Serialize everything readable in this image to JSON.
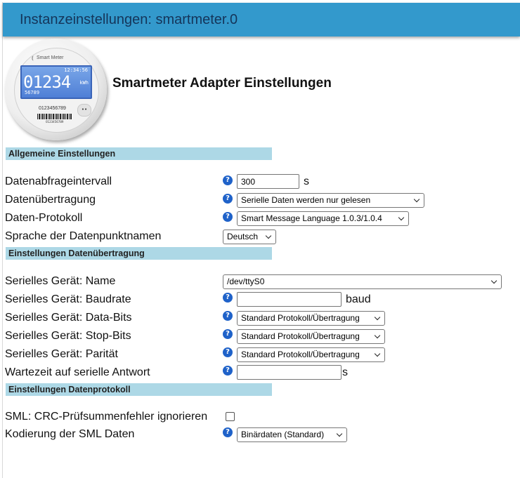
{
  "window": {
    "title": "Instanzeinstellungen: smartmeter.0"
  },
  "logo": {
    "brand": "Smart Meter",
    "time": "12:34:56",
    "reading": "01234",
    "unit": "kWh",
    "sub": "56789",
    "serial": "0123456789",
    "barcode_number": "0123456789",
    "dots": "••"
  },
  "page_title": "Smartmeter Adapter Einstellungen",
  "sections": {
    "general": "Allgemeine Einstellungen",
    "transfer": "Einstellungen Datenübertragung",
    "protocol": "Einstellungen Datenprotokoll"
  },
  "general": {
    "interval": {
      "label": "Datenabfrageintervall",
      "value": "300",
      "unit": "s"
    },
    "transfer": {
      "label": "Datenübertragung",
      "value": "Serielle Daten werden nur gelesen"
    },
    "protocol": {
      "label": "Daten-Protokoll",
      "value": "Smart Message Language 1.0.3/1.0.4"
    },
    "language": {
      "label": "Sprache der Datenpunktnamen",
      "value": "Deutsch"
    }
  },
  "serial": {
    "name": {
      "label": "Serielles Gerät: Name",
      "value": "/dev/ttyS0"
    },
    "baud": {
      "label": "Serielles Gerät: Baudrate",
      "value": "",
      "unit": "baud"
    },
    "databits": {
      "label": "Serielles Gerät: Data-Bits",
      "value": "Standard Protokoll/Übertragung"
    },
    "stopbits": {
      "label": "Serielles Gerät: Stop-Bits",
      "value": "Standard Protokoll/Übertragung"
    },
    "parity": {
      "label": "Serielles Gerät: Parität",
      "value": "Standard Protokoll/Übertragung"
    },
    "wait": {
      "label": "Wartezeit auf serielle Antwort",
      "value": "",
      "unit": "s"
    }
  },
  "protocol": {
    "crc": {
      "label": "SML: CRC-Prüfsummenfehler ignorieren",
      "checked": false
    },
    "encoding": {
      "label": "Kodierung der SML Daten",
      "value": "Binärdaten (Standard)"
    }
  },
  "help_glyph": "?",
  "colors": {
    "titlebar": "#3399cc",
    "section": "#add8e6",
    "help": "#1f62c9"
  },
  "icons": {
    "help": "question-circle-icon",
    "dropdown": "chevron-down-icon"
  }
}
